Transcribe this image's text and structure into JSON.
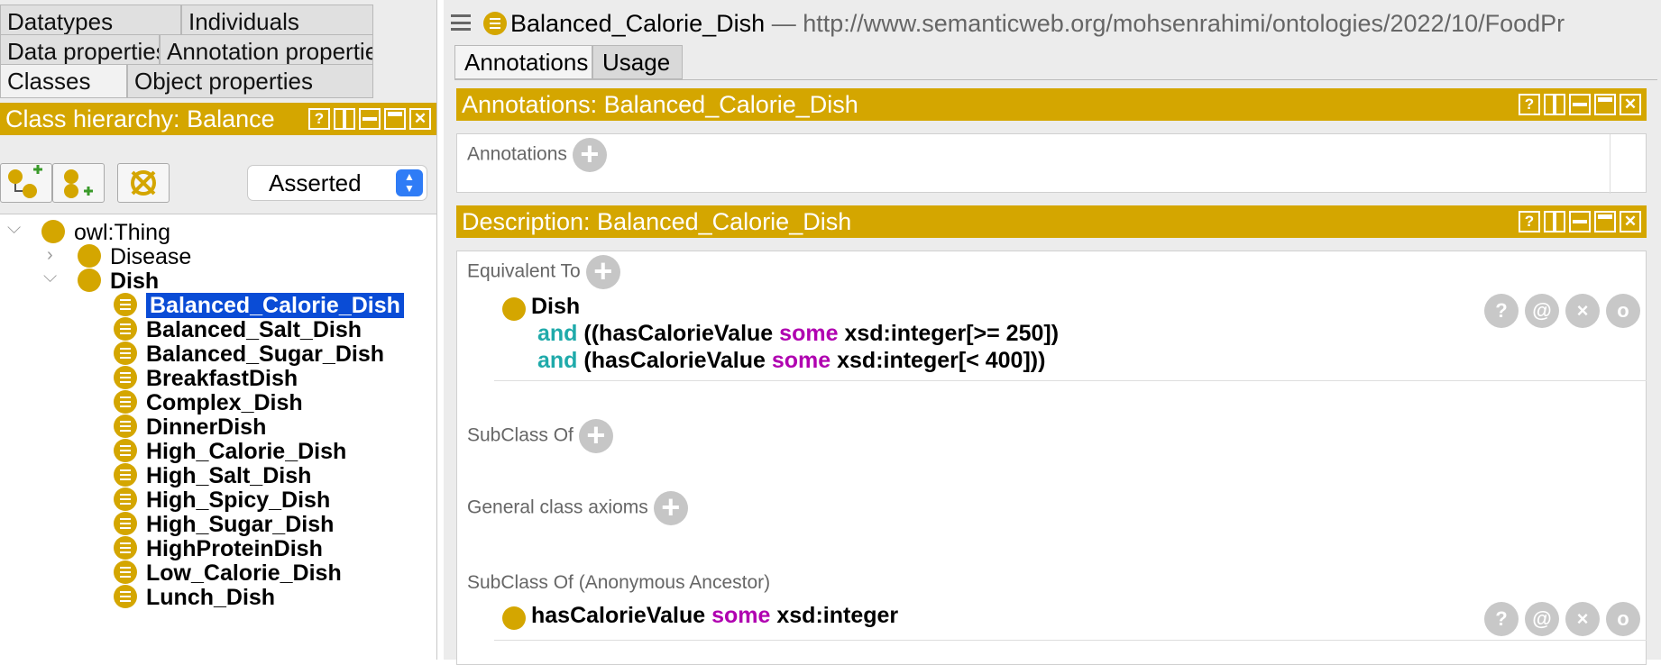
{
  "left": {
    "tabs_row1": [
      "Datatypes",
      "Individuals"
    ],
    "tabs_row2": [
      "Data properties",
      "Annotation properties"
    ],
    "tabs_row3": [
      "Classes",
      "Object properties"
    ],
    "hierarchy_title": "Class hierarchy: Balance",
    "view_mode": "Asserted",
    "tree": {
      "root": "owl:Thing",
      "disease": "Disease",
      "dish": "Dish",
      "children": [
        "Balanced_Calorie_Dish",
        "Balanced_Salt_Dish",
        "Balanced_Sugar_Dish",
        "BreakfastDish",
        "Complex_Dish",
        "DinnerDish",
        "High_Calorie_Dish",
        "High_Salt_Dish",
        "High_Spicy_Dish",
        "High_Sugar_Dish",
        "HighProteinDish",
        "Low_Calorie_Dish",
        "Lunch_Dish"
      ]
    }
  },
  "right": {
    "entity": "Balanced_Calorie_Dish",
    "iri": "— http://www.semanticweb.org/mohsenrahimi/ontologies/2022/10/FoodPr",
    "tabs": [
      "Annotations",
      "Usage"
    ],
    "annotations_title": "Annotations: Balanced_Calorie_Dish",
    "annotations_label": "Annotations",
    "description_title": "Description: Balanced_Calorie_Dish",
    "equivalent_label": "Equivalent To",
    "equiv": {
      "cls": "Dish",
      "and1": "and",
      "l1a": "((hasCalorieValue",
      "some1": "some",
      "l1b": "xsd:integer[>= 250])",
      "and2": "and",
      "l2a": "(hasCalorieValue",
      "some2": "some",
      "l2b": "xsd:integer[< 400]))"
    },
    "subclass_label": "SubClass Of",
    "gca_label": "General class axioms",
    "anon_label": "SubClass Of (Anonymous Ancestor)",
    "anon": {
      "a": "hasCalorieValue",
      "some": "some",
      "b": "xsd:integer"
    },
    "action_icons": [
      "?",
      "@",
      "×",
      "o"
    ]
  }
}
